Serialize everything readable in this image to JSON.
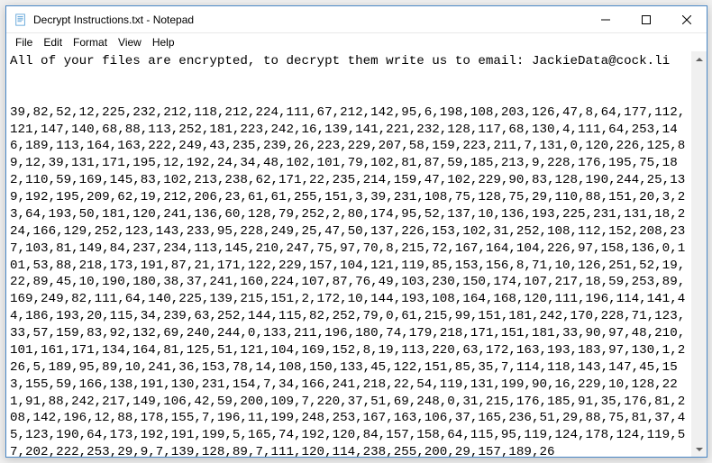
{
  "window": {
    "title": "Decrypt Instructions.txt - Notepad"
  },
  "menu": {
    "file": "File",
    "edit": "Edit",
    "format": "Format",
    "view": "View",
    "help": "Help"
  },
  "document": {
    "text": "All of your files are encrypted, to decrypt them write us to email: JackieData@cock.li\n\n\n39,82,52,12,225,232,212,118,212,224,111,67,212,142,95,6,198,108,203,126,47,8,64,177,112,121,147,140,68,88,113,252,181,223,242,16,139,141,221,232,128,117,68,130,4,111,64,253,146,189,113,164,163,222,249,43,235,239,26,223,229,207,58,159,223,211,7,131,0,120,226,125,89,12,39,131,171,195,12,192,24,34,48,102,101,79,102,81,87,59,185,213,9,228,176,195,75,182,110,59,169,145,83,102,213,238,62,171,22,235,214,159,47,102,229,90,83,128,190,244,25,139,192,195,209,62,19,212,206,23,61,61,255,151,3,39,231,108,75,128,75,29,110,88,151,20,3,23,64,193,50,181,120,241,136,60,128,79,252,2,80,174,95,52,137,10,136,193,225,231,131,18,224,166,129,252,123,143,233,95,228,249,25,47,50,137,226,153,102,31,252,108,112,152,208,237,103,81,149,84,237,234,113,145,210,247,75,97,70,8,215,72,167,164,104,226,97,158,136,0,101,53,88,218,173,191,87,21,171,122,229,157,104,121,119,85,153,156,8,71,10,126,251,52,19,22,89,45,10,190,180,38,37,241,160,224,107,87,76,49,103,230,150,174,107,217,18,59,253,89,169,249,82,111,64,140,225,139,215,151,2,172,10,144,193,108,164,168,120,111,196,114,141,44,186,193,20,115,34,239,63,252,144,115,82,252,79,0,61,215,99,151,181,242,170,228,71,123,33,57,159,83,92,132,69,240,244,0,133,211,196,180,74,179,218,171,151,181,33,90,97,48,210,101,161,171,134,164,81,125,51,121,104,169,152,8,19,113,220,63,172,163,193,183,97,130,1,226,5,189,95,89,10,241,36,153,78,14,108,150,133,45,122,151,85,35,7,114,118,143,147,45,153,155,59,166,138,191,130,231,154,7,34,166,241,218,22,54,119,131,199,90,16,229,10,128,221,91,88,242,217,149,106,42,59,200,109,7,220,37,51,69,248,0,31,215,176,185,91,35,176,81,208,142,196,12,88,178,155,7,196,11,199,248,253,167,163,106,37,165,236,51,29,88,75,81,37,45,123,190,64,173,192,191,199,5,165,74,192,120,84,157,158,64,115,95,119,124,178,124,119,57,202,222,253,29,9,7,139,128,89,7,111,120,114,238,255,200,29,157,189,26"
  },
  "controls": {
    "minimize": "minimize",
    "maximize": "maximize",
    "close": "close"
  }
}
